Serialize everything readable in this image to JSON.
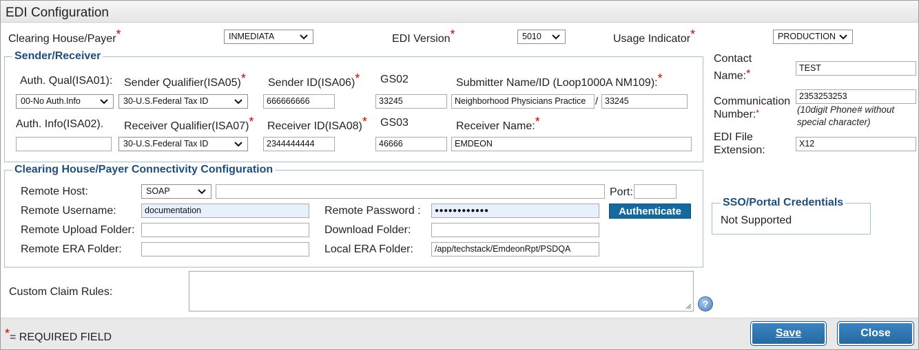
{
  "window": {
    "title": "EDI Configuration"
  },
  "top": {
    "clearing_label": "Clearing House/Payer",
    "clearing_value": "INMEDIATA",
    "edi_version_label": "EDI Version",
    "edi_version_value": "5010",
    "usage_label": "Usage Indicator",
    "usage_value": "PRODUCTION"
  },
  "sender": {
    "legend": "Sender/Receiver",
    "auth_qual_label": "Auth. Qual(ISA01):",
    "auth_qual_value": "00-No Auth.Info",
    "sender_qual_label": "Sender Qualifier(ISA05)",
    "sender_qual_value": "30-U.S.Federal Tax ID",
    "sender_id_label": "Sender ID(ISA06)",
    "sender_id_value": "666666666",
    "gs02_label": "GS02",
    "gs02_value": "33245",
    "submitter_label": "Submitter Name/ID (Loop1000A NM109):",
    "submitter_name_value": "Neighborhood Physicians Practice",
    "separator": "/",
    "submitter_id_value": "33245",
    "auth_info_label": "Auth. Info(ISA02).",
    "auth_info_value": "",
    "receiver_qual_label": "Receiver Qualifier(ISA07)",
    "receiver_qual_value": "30-U.S.Federal Tax ID",
    "receiver_id_label": "Receiver ID(ISA08)",
    "receiver_id_value": "2344444444",
    "gs03_label": "GS03",
    "gs03_value": "46666",
    "receiver_name_label": "Receiver Name:",
    "receiver_name_value": "EMDEON"
  },
  "connectivity": {
    "legend": "Clearing House/Payer Connectivity Configuration",
    "remote_host_label": "Remote Host:",
    "remote_host_type": "SOAP",
    "remote_host_value": "",
    "port_label": "Port:",
    "port_value": "",
    "remote_username_label": "Remote Username:",
    "remote_username_value": "documentation",
    "remote_password_label": "Remote Password :",
    "remote_password_value": "●●●●●●●●●●●●",
    "authenticate_label": "Authenticate",
    "remote_upload_label": "Remote Upload Folder:",
    "remote_upload_value": "",
    "download_label": "Download Folder:",
    "download_value": "",
    "remote_era_label": "Remote ERA Folder:",
    "remote_era_value": "",
    "local_era_label": "Local ERA Folder:",
    "local_era_value": "/app/techstack/EmdeonRpt/PSDQA"
  },
  "contact": {
    "name_label_1": "Contact",
    "name_label_2": "Name:",
    "name_value": "TEST",
    "comm_label_1": "Communication",
    "comm_label_2": "Number:",
    "comm_value": "2353253253",
    "comm_hint_1": "(10digit Phone# without",
    "comm_hint_2": "special character)",
    "ext_label_1": "EDI File",
    "ext_label_2": "Extension:",
    "ext_value": "X12"
  },
  "sso": {
    "legend": "SSO/Portal Credentials",
    "value": "Not Supported"
  },
  "custom": {
    "label": "Custom Claim Rules:",
    "value": "",
    "help_glyph": "?"
  },
  "footer": {
    "required_star": "*",
    "required_label": "= REQUIRED FIELD",
    "save_label": "Save",
    "close_label": "Close"
  },
  "required_mark": "*",
  "colors": {
    "accent": "#14699e",
    "legend": "#1c4e80",
    "required": "#d40000",
    "autofill": "#e8f0fe"
  }
}
